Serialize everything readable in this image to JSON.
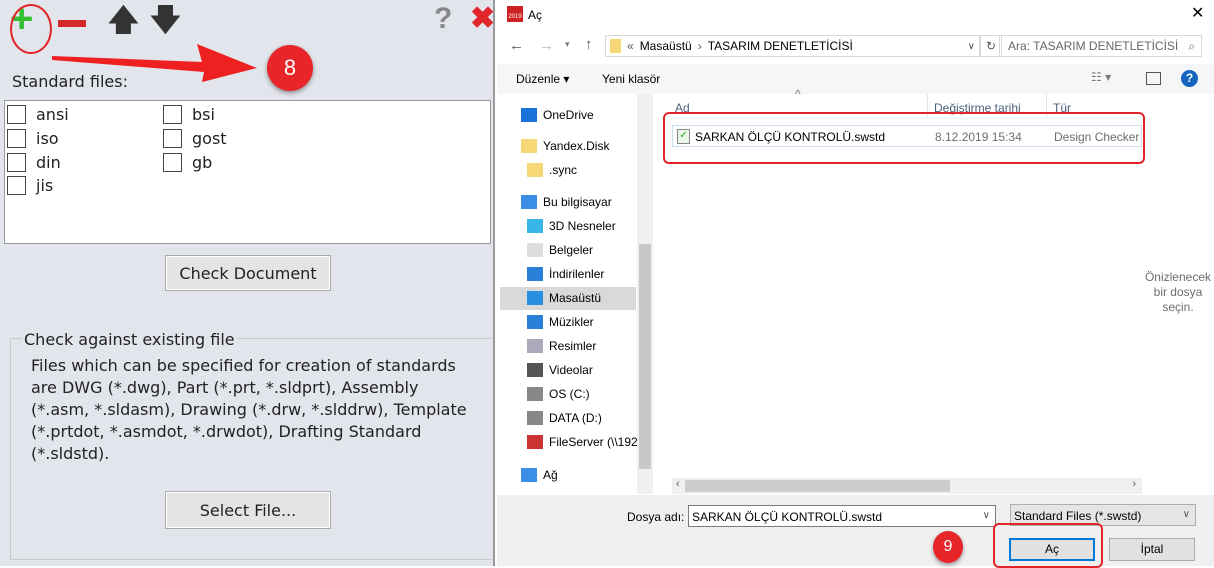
{
  "left_panel": {
    "toolbar": {
      "add": "add-icon",
      "remove": "remove-icon",
      "up": "arrow-up-icon",
      "down": "arrow-down-icon",
      "help": "help-icon",
      "close": "close-icon"
    },
    "annotation_step": "8",
    "standard_files_label": "Standard files:",
    "standards": [
      {
        "label": "ansi",
        "checked": false
      },
      {
        "label": "iso",
        "checked": false
      },
      {
        "label": "din",
        "checked": false
      },
      {
        "label": "jis",
        "checked": false
      },
      {
        "label": "bsi",
        "checked": false
      },
      {
        "label": "gost",
        "checked": false
      },
      {
        "label": "gb",
        "checked": false
      }
    ],
    "check_document_button": "Check Document",
    "group_title": "Check against existing file",
    "group_description": "Files which can be specified for creation of standards are DWG (*.dwg), Part (*.prt, *.sldprt), Assembly (*.asm, *.sldasm), Drawing (*.drw, *.slddrw), Template (*.prtdot, *.asmdot, *.drwdot), Drafting Standard (*.sldstd).",
    "select_file_button": "Select File..."
  },
  "dialog": {
    "title": "Aç",
    "app_icon_text": "2019",
    "breadcrumb": {
      "prefix": "«",
      "items": [
        "Masaüstü",
        "TASARIM DENETLETİCİSİ"
      ]
    },
    "search_placeholder": "Ara: TASARIM DENETLETİCİSİ",
    "toolbar": {
      "organize": "Düzenle",
      "new_folder": "Yeni klasör"
    },
    "nav_items": [
      {
        "label": "OneDrive",
        "icon": "cloud-icon",
        "level": 0
      },
      {
        "label": "Yandex.Disk",
        "icon": "folder-icon",
        "level": 0
      },
      {
        "label": ".sync",
        "icon": "folder-icon",
        "level": 1
      },
      {
        "label": "Bu bilgisayar",
        "icon": "computer-icon",
        "level": 0
      },
      {
        "label": "3D Nesneler",
        "icon": "cube-icon",
        "level": 1
      },
      {
        "label": "Belgeler",
        "icon": "document-icon",
        "level": 1
      },
      {
        "label": "İndirilenler",
        "icon": "download-icon",
        "level": 1
      },
      {
        "label": "Masaüstü",
        "icon": "desktop-icon",
        "level": 1,
        "selected": true
      },
      {
        "label": "Müzikler",
        "icon": "music-icon",
        "level": 1
      },
      {
        "label": "Resimler",
        "icon": "picture-icon",
        "level": 1
      },
      {
        "label": "Videolar",
        "icon": "video-icon",
        "level": 1
      },
      {
        "label": "OS (C:)",
        "icon": "drive-icon",
        "level": 1
      },
      {
        "label": "DATA (D:)",
        "icon": "drive-icon",
        "level": 1
      },
      {
        "label": "FileServer (\\\\192",
        "icon": "network-drive-icon",
        "level": 1
      },
      {
        "label": "Ağ",
        "icon": "network-icon",
        "level": 0
      }
    ],
    "columns": [
      "Ad",
      "Değiştirme tarihi",
      "Tür"
    ],
    "files": [
      {
        "name": "SARKAN ÖLÇÜ KONTROLÜ.swstd",
        "modified": "8.12.2019 15:34",
        "type": "Design Checker"
      }
    ],
    "preview_text": "Önizlenecek bir dosya seçin.",
    "filename_label": "Dosya adı:",
    "filename_value": "SARKAN ÖLÇÜ KONTROLÜ.swstd",
    "filetype_value": "Standard Files (*.swstd)",
    "open_button": "Aç",
    "cancel_button": "İptal",
    "annotation_step": "9"
  },
  "colors": {
    "annotation": "#e0262a",
    "accent": "#0078d7",
    "selected": "#d9d9d9"
  }
}
